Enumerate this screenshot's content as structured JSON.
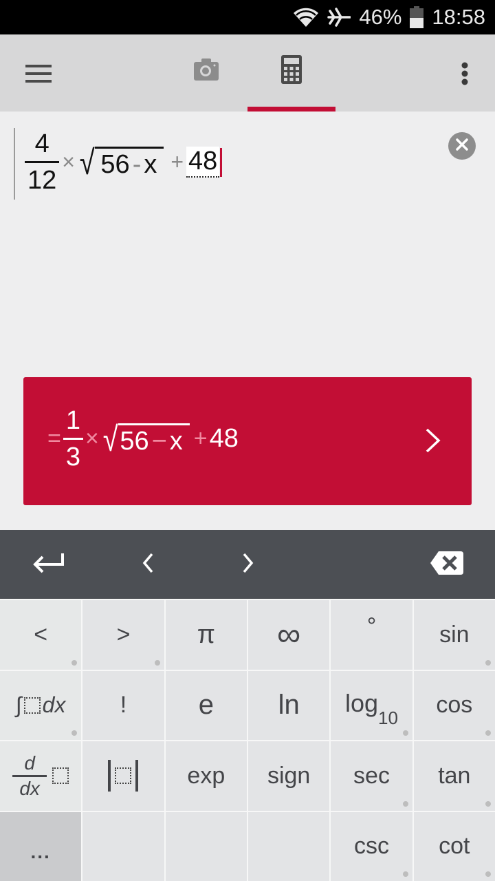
{
  "status_bar": {
    "wifi_icon": "wifi-icon",
    "airplane_icon": "airplane-icon",
    "battery_percent": "46%",
    "battery_icon": "battery-icon",
    "time": "18:58"
  },
  "toolbar": {
    "menu_icon": "hamburger-menu-icon",
    "tabs": [
      {
        "name": "camera",
        "icon": "camera-icon",
        "active": false
      },
      {
        "name": "calculator",
        "icon": "calculator-icon",
        "active": true
      }
    ],
    "overflow_icon": "more-vert-icon",
    "accent_color": "#c20e35"
  },
  "editor": {
    "expression": {
      "fraction": {
        "numerator": "4",
        "denominator": "12"
      },
      "times": "×",
      "sqrt_radicand": {
        "left": "56",
        "minus": "-",
        "right": "x"
      },
      "plus": "+",
      "active_term": "48"
    },
    "clear_icon": "clear-circle-icon"
  },
  "result": {
    "equals": "=",
    "fraction": {
      "numerator": "1",
      "denominator": "3"
    },
    "times": "×",
    "sqrt_radicand": {
      "left": "56",
      "minus": "−",
      "right": "x"
    },
    "plus": "+",
    "constant": "48",
    "chevron_icon": "chevron-right-icon",
    "background_color": "#c20e35"
  },
  "nav_bar": {
    "enter_icon": "enter-return-icon",
    "left_icon": "cursor-left-icon",
    "right_icon": "cursor-right-icon",
    "backspace_icon": "backspace-icon"
  },
  "keypad": {
    "keys": [
      {
        "label": "<",
        "dot": true
      },
      {
        "label": ">",
        "dot": true
      },
      {
        "label": "π",
        "dot": false
      },
      {
        "label": "∞",
        "dot": false
      },
      {
        "label": "°",
        "dot": false
      },
      {
        "label": "sin",
        "dot": true
      },
      {
        "label": "∫□dx",
        "dot": true
      },
      {
        "label": "!",
        "dot": false
      },
      {
        "label": "e",
        "dot": false
      },
      {
        "label": "ln",
        "dot": false
      },
      {
        "label": "log",
        "sub": "10",
        "dot": true
      },
      {
        "label": "cos",
        "dot": true
      },
      {
        "label": "d/dx □",
        "dot": false
      },
      {
        "label": "|□|",
        "dot": false
      },
      {
        "label": "exp",
        "dot": false
      },
      {
        "label": "sign",
        "dot": false
      },
      {
        "label": "sec",
        "dot": true
      },
      {
        "label": "tan",
        "dot": true
      },
      {
        "label": "...",
        "dot": false
      },
      {
        "label": "",
        "dot": false
      },
      {
        "label": "",
        "dot": false
      },
      {
        "label": "",
        "dot": false
      },
      {
        "label": "csc",
        "dot": true
      },
      {
        "label": "cot",
        "dot": true
      }
    ]
  }
}
